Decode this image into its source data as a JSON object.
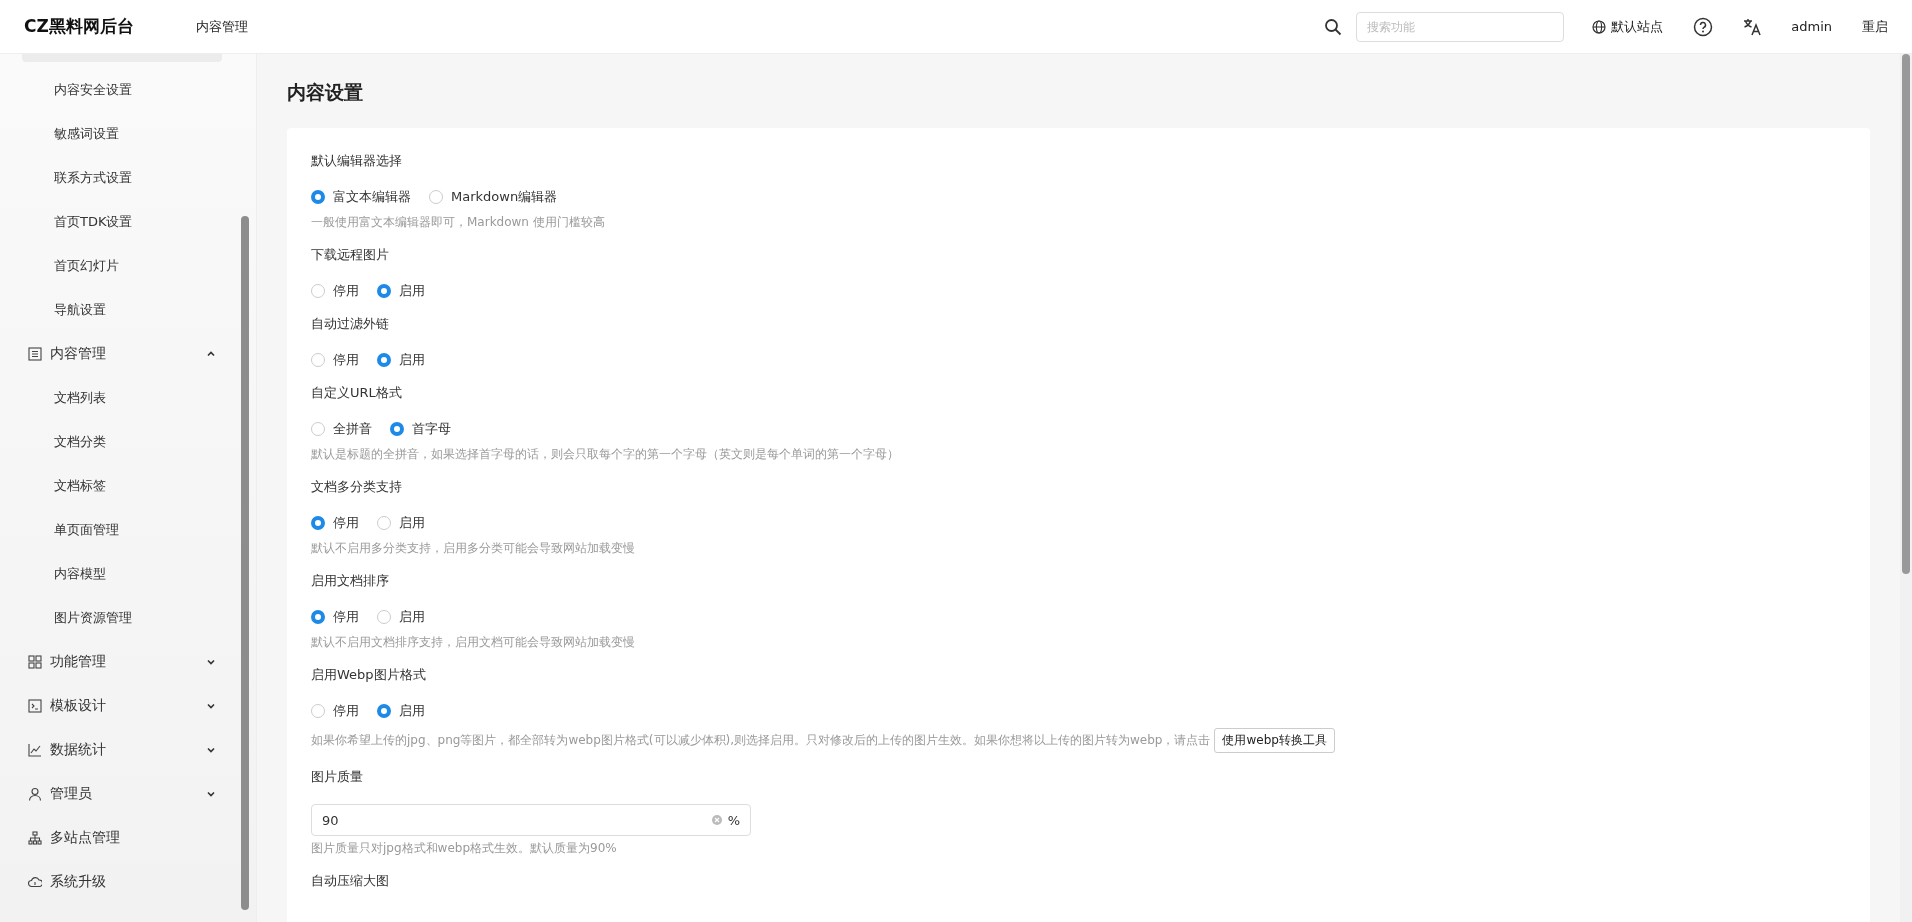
{
  "header": {
    "logo": "CZ黑料网后台",
    "nav": "内容管理",
    "search": {
      "placeholder": "搜索功能"
    },
    "site": "默认站点",
    "user": "admin",
    "restart": "重启"
  },
  "sidebar": {
    "items": [
      {
        "kind": "child",
        "label": "内容安全设置"
      },
      {
        "kind": "child",
        "label": "敏感词设置"
      },
      {
        "kind": "child",
        "label": "联系方式设置"
      },
      {
        "kind": "child",
        "label": "首页TDK设置"
      },
      {
        "kind": "child",
        "label": "首页幻灯片"
      },
      {
        "kind": "child",
        "label": "导航设置"
      },
      {
        "kind": "group",
        "label": "内容管理",
        "expanded": true,
        "children": [
          {
            "label": "文档列表"
          },
          {
            "label": "文档分类"
          },
          {
            "label": "文档标签"
          },
          {
            "label": "单页面管理"
          },
          {
            "label": "内容模型"
          },
          {
            "label": "图片资源管理"
          }
        ]
      },
      {
        "kind": "group",
        "label": "功能管理",
        "expanded": false
      },
      {
        "kind": "group",
        "label": "模板设计",
        "expanded": false
      },
      {
        "kind": "group",
        "label": "数据统计",
        "expanded": false
      },
      {
        "kind": "group",
        "label": "管理员",
        "expanded": false
      },
      {
        "kind": "link",
        "label": "多站点管理"
      },
      {
        "kind": "link",
        "label": "系统升级"
      }
    ]
  },
  "page": {
    "title": "内容设置",
    "fields": [
      {
        "kind": "radio",
        "label": "默认编辑器选择",
        "options": [
          {
            "label": "富文本编辑器",
            "selected": true
          },
          {
            "label": "Markdown编辑器",
            "selected": false
          }
        ],
        "hint": "一般使用富文本编辑器即可，Markdown 使用门槛较高"
      },
      {
        "kind": "radio",
        "label": "下载远程图片",
        "options": [
          {
            "label": "停用",
            "selected": false
          },
          {
            "label": "启用",
            "selected": true
          }
        ]
      },
      {
        "kind": "radio",
        "label": "自动过滤外链",
        "options": [
          {
            "label": "停用",
            "selected": false
          },
          {
            "label": "启用",
            "selected": true
          }
        ]
      },
      {
        "kind": "radio",
        "label": "自定义URL格式",
        "options": [
          {
            "label": "全拼音",
            "selected": false
          },
          {
            "label": "首字母",
            "selected": true
          }
        ],
        "hint": "默认是标题的全拼音，如果选择首字母的话，则会只取每个字的第一个字母（英文则是每个单词的第一个字母）"
      },
      {
        "kind": "radio",
        "label": "文档多分类支持",
        "options": [
          {
            "label": "停用",
            "selected": true
          },
          {
            "label": "启用",
            "selected": false
          }
        ],
        "hint": "默认不启用多分类支持，启用多分类可能会导致网站加载变慢"
      },
      {
        "kind": "radio",
        "label": "启用文档排序",
        "options": [
          {
            "label": "停用",
            "selected": true
          },
          {
            "label": "启用",
            "selected": false
          }
        ],
        "hint": "默认不启用文档排序支持，启用文档可能会导致网站加载变慢"
      },
      {
        "kind": "radio",
        "label": "启用Webp图片格式",
        "options": [
          {
            "label": "停用",
            "selected": false
          },
          {
            "label": "启用",
            "selected": true
          }
        ],
        "hint": "如果你希望上传的jpg、png等图片，都全部转为webp图片格式(可以减少体积),则选择启用。只对修改后的上传的图片生效。如果你想将以上传的图片转为webp，请点击",
        "button": "使用webp转换工具"
      },
      {
        "kind": "number",
        "label": "图片质量",
        "value": "90",
        "suffix": "%",
        "hint": "图片质量只对jpg格式和webp格式生效。默认质量为90%"
      },
      {
        "kind": "heading",
        "label": "自动压缩大图"
      }
    ]
  }
}
